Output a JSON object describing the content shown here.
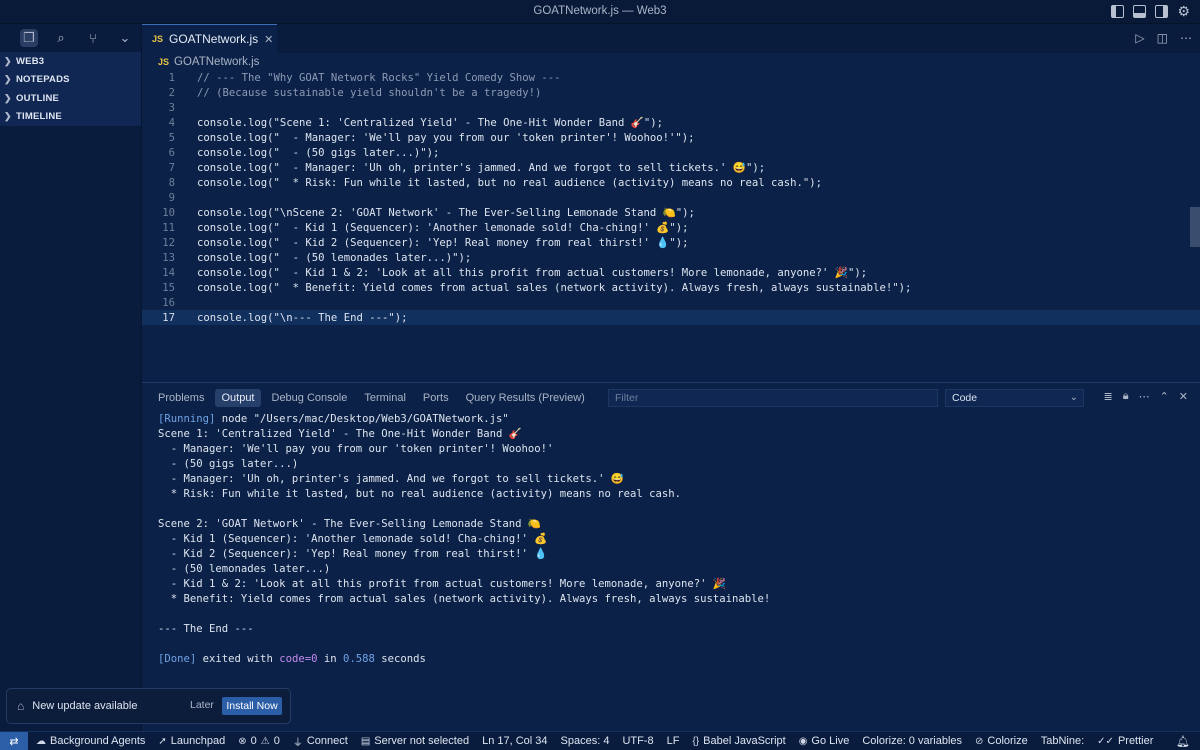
{
  "window": {
    "title": "GOATNetwork.js — Web3"
  },
  "sidebar": {
    "sections": [
      {
        "label": "WEB3"
      },
      {
        "label": "NOTEPADS"
      },
      {
        "label": "OUTLINE"
      },
      {
        "label": "TIMELINE"
      }
    ]
  },
  "editor": {
    "tab_label": "GOATNetwork.js",
    "tab_badge": "JS",
    "breadcrumb": "GOATNetwork.js",
    "lines": [
      {
        "n": "1",
        "text": "// --- The \"Why GOAT Network Rocks\" Yield Comedy Show ---"
      },
      {
        "n": "2",
        "text": "// (Because sustainable yield shouldn't be a tragedy!)"
      },
      {
        "n": "3",
        "text": ""
      },
      {
        "n": "4",
        "text": "console.log(\"Scene 1: 'Centralized Yield' - The One-Hit Wonder Band 🎸\");"
      },
      {
        "n": "5",
        "text": "console.log(\"  - Manager: 'We'll pay you from our 'token printer'! Woohoo!'\");"
      },
      {
        "n": "6",
        "text": "console.log(\"  - (50 gigs later...)\");"
      },
      {
        "n": "7",
        "text": "console.log(\"  - Manager: 'Uh oh, printer's jammed. And we forgot to sell tickets.' 😅\");"
      },
      {
        "n": "8",
        "text": "console.log(\"  * Risk: Fun while it lasted, but no real audience (activity) means no real cash.\");"
      },
      {
        "n": "9",
        "text": ""
      },
      {
        "n": "10",
        "text": "console.log(\"\\nScene 2: 'GOAT Network' - The Ever-Selling Lemonade Stand 🍋\");"
      },
      {
        "n": "11",
        "text": "console.log(\"  - Kid 1 (Sequencer): 'Another lemonade sold! Cha-ching!' 💰\");"
      },
      {
        "n": "12",
        "text": "console.log(\"  - Kid 2 (Sequencer): 'Yep! Real money from real thirst!' 💧\");"
      },
      {
        "n": "13",
        "text": "console.log(\"  - (50 lemonades later...)\");"
      },
      {
        "n": "14",
        "text": "console.log(\"  - Kid 1 & 2: 'Look at all this profit from actual customers! More lemonade, anyone?' 🎉\");"
      },
      {
        "n": "15",
        "text": "console.log(\"  * Benefit: Yield comes from actual sales (network activity). Always fresh, always sustainable!\");"
      },
      {
        "n": "16",
        "text": ""
      },
      {
        "n": "17",
        "text": "console.log(\"\\n--- The End ---\");"
      }
    ]
  },
  "panel": {
    "tabs": [
      {
        "label": "Problems"
      },
      {
        "label": "Output"
      },
      {
        "label": "Debug Console"
      },
      {
        "label": "Terminal"
      },
      {
        "label": "Ports"
      },
      {
        "label": "Query Results (Preview)"
      }
    ],
    "filter_placeholder": "Filter",
    "channel": "Code",
    "running_tag": "[Running]",
    "running_cmd": " node \"/Users/mac/Desktop/Web3/GOATNetwork.js\"",
    "output_lines": [
      "Scene 1: 'Centralized Yield' - The One-Hit Wonder Band 🎸",
      "  - Manager: 'We'll pay you from our 'token printer'! Woohoo!'",
      "  - (50 gigs later...)",
      "  - Manager: 'Uh oh, printer's jammed. And we forgot to sell tickets.' 😅",
      "  * Risk: Fun while it lasted, but no real audience (activity) means no real cash.",
      "",
      "Scene 2: 'GOAT Network' - The Ever-Selling Lemonade Stand 🍋",
      "  - Kid 1 (Sequencer): 'Another lemonade sold! Cha-ching!' 💰",
      "  - Kid 2 (Sequencer): 'Yep! Real money from real thirst!' 💧",
      "  - (50 lemonades later...)",
      "  - Kid 1 & 2: 'Look at all this profit from actual customers! More lemonade, anyone?' 🎉",
      "  * Benefit: Yield comes from actual sales (network activity). Always fresh, always sustainable!",
      "",
      "--- The End ---",
      ""
    ],
    "done_tag": "[Done]",
    "done_pre": " exited with ",
    "done_code": "code=0",
    "done_in": " in ",
    "done_secs": "0.588",
    "done_post": " seconds"
  },
  "notification": {
    "text": "New update available",
    "later": "Later",
    "install": "Install Now"
  },
  "status": {
    "background_agents": "Background Agents",
    "launchpad": "Launchpad",
    "errors": "0",
    "warnings": "0",
    "connect": "Connect",
    "server": "Server not selected",
    "position": "Ln 17, Col 34",
    "spaces": "Spaces: 4",
    "encoding": "UTF-8",
    "eol": "LF",
    "language": "Babel JavaScript",
    "golive": "Go Live",
    "colorize_vars": "Colorize: 0 variables",
    "colorize": "Colorize",
    "tabnine": "TabNine:",
    "prettier": "Prettier"
  }
}
